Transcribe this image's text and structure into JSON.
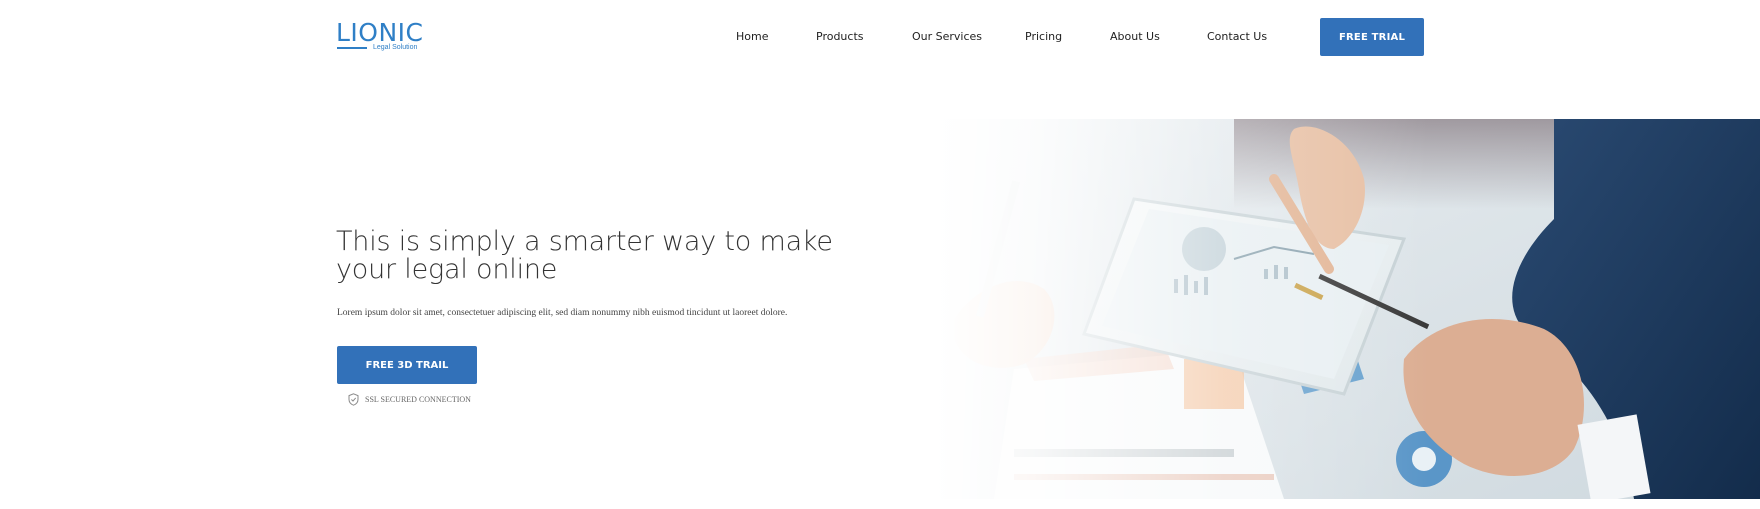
{
  "brand": {
    "name": "LIONIC",
    "tagline": "Legal Solution"
  },
  "nav": {
    "items": [
      {
        "label": "Home"
      },
      {
        "label": "Products"
      },
      {
        "label": "Our Services"
      },
      {
        "label": "Pricing"
      },
      {
        "label": "About Us"
      },
      {
        "label": "Contact Us"
      }
    ],
    "cta_label": "FREE TRIAL"
  },
  "hero": {
    "headline": "This is simply a smarter way to make your legal online",
    "subtext": "Lorem ipsum dolor sit amet, consectetuer adipiscing elit, sed diam nonummy nibh euismod tincidunt ut laoreet dolore.",
    "cta_label": "FREE 3D TRAIL",
    "ssl_text": "SSL SECURED CONNECTION"
  },
  "colors": {
    "brand": "#2f7fc6",
    "primary": "#3271b9",
    "text": "#333333"
  },
  "icons": {
    "ssl": "shield-check-icon"
  }
}
